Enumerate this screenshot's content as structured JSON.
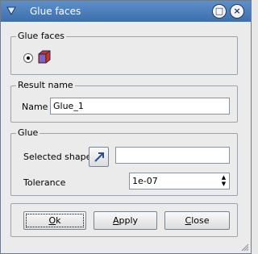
{
  "window": {
    "title": "Glue faces"
  },
  "glue_faces_group": {
    "title": "Glue faces",
    "mode_selected": true
  },
  "result_group": {
    "title": "Result name",
    "name_label": "Name",
    "name_value": "Glue_1"
  },
  "glue_group": {
    "title": "Glue",
    "selected_shape_label": "Selected shape",
    "selected_shape_value": "",
    "tolerance_label": "Tolerance",
    "tolerance_value": "1e-07"
  },
  "buttons": {
    "ok": "Ok",
    "apply": "Apply",
    "close": "Close"
  },
  "icons": {
    "title": "app-icon",
    "maximize": "maximize-icon",
    "close": "close-icon",
    "glue_faces": "box-faces-icon",
    "select": "select-arrow-icon",
    "resize": "resize-grip-icon"
  },
  "colors": {
    "titlebar": "#4a7dbc",
    "accent": "#2a4f8a"
  }
}
